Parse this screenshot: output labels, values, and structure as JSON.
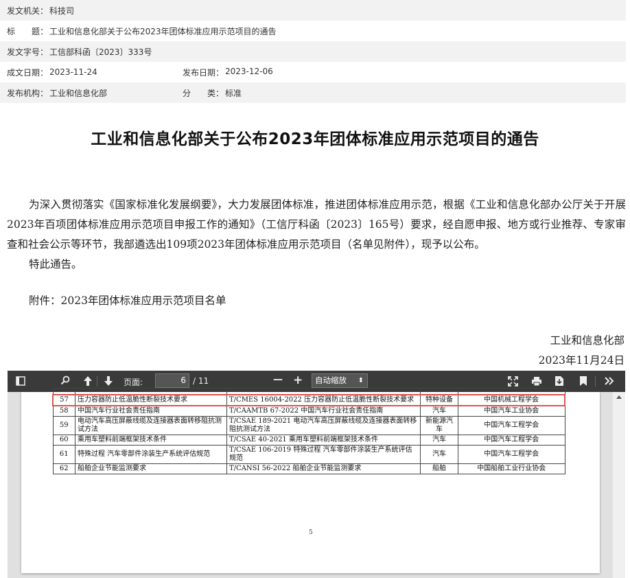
{
  "meta": {
    "issuer_label": "发文机关：",
    "issuer": "科技司",
    "title_label": "标　　题：",
    "title": "工业和信息化部关于公布2023年团体标准应用示范项目的通告",
    "docno_label": "发文字号：",
    "docno": "工信部科函〔2023〕333号",
    "written_label": "成文日期：",
    "written": "2023-11-24",
    "published_label": "发布日期：",
    "published": "2023-12-06",
    "org_label": "发布机构：",
    "org": "工业和信息化部",
    "category_label": "分　　类：",
    "category": "标准"
  },
  "document": {
    "heading": "工业和信息化部关于公布2023年团体标准应用示范项目的通告",
    "paragraph1": "为深入贯彻落实《国家标准化发展纲要》，大力发展团体标准，推进团体标准应用示范，根据《工业和信息化部办公厅关于开展2023年百项团体标准应用示范项目申报工作的通知》（工信厅科函〔2023〕165号）要求，经自愿申报、地方或行业推荐、专家审查和社会公示等环节，我部遴选出109项2023年团体标准应用示范项目（名单见附件），现予以公布。",
    "paragraph2": "特此通告。",
    "attachment": "附件：2023年团体标准应用示范项目名单",
    "signature_org": "工业和信息化部",
    "signature_date": "2023年11月24日"
  },
  "viewer": {
    "page_label": "页面:",
    "page_current": "6",
    "page_total": "/ 11",
    "zoom_minus": "—",
    "zoom_plus": "+",
    "zoom_value": "自动缩放",
    "zoom_caret": "⬍",
    "page_footer_number": "5",
    "rows": [
      {
        "no": "57",
        "name": "压力容器防止低温脆性断裂技术要求",
        "code": "T/CMES 16004-2022 压力容器防止低温脆性断裂技术要求",
        "industry": "特种设备",
        "org": "中国机械工程学会"
      },
      {
        "no": "58",
        "name": "中国汽车行业社会责任指南",
        "code": "T/CAAMTB 67-2022 中国汽车行业社会责任指南",
        "industry": "汽车",
        "org": "中国汽车工业协会"
      },
      {
        "no": "59",
        "name": "电动汽车高压屏蔽线缆及连接器表面转移阻抗测试方法",
        "code": "T/CSAE 189-2021 电动汽车高压屏蔽线缆及连接器表面转移阻抗测试方法",
        "industry": "新能源汽车",
        "org": "中国汽车工程学会"
      },
      {
        "no": "60",
        "name": "乘用车塑料前端框架技术条件",
        "code": "T/CSAE 40-2021 乘用车塑料前端框架技术条件",
        "industry": "汽车",
        "org": "中国汽车工程学会"
      },
      {
        "no": "61",
        "name": "特殊过程 汽车零部件涂装生产系统评估规范",
        "code": "T/CSAE 106-2019 特殊过程 汽车零部件涂装生产系统评估规范",
        "industry": "汽车",
        "org": "中国汽车工程学会"
      },
      {
        "no": "62",
        "name": "船舶企业节能监测要求",
        "code": "T/CANSI 56-2022 船舶企业节能监测要求",
        "industry": "船舶",
        "org": "中国船舶工业行业协会"
      }
    ]
  }
}
